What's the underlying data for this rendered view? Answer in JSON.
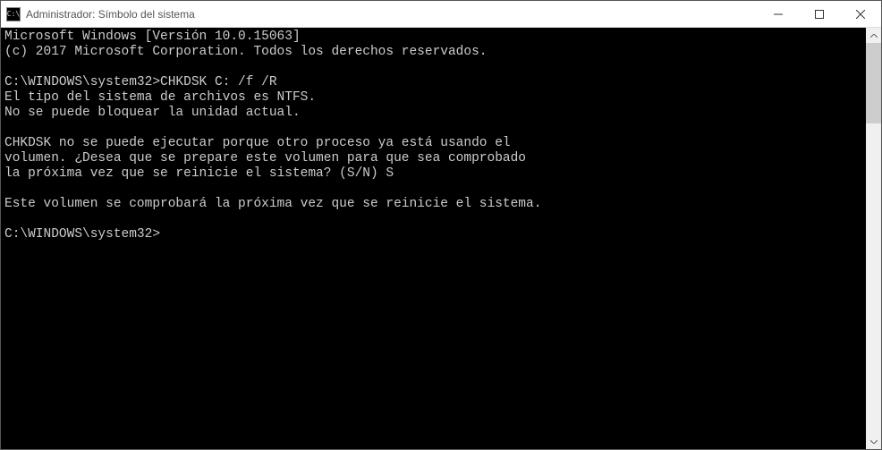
{
  "window": {
    "title": "Administrador: Símbolo del sistema",
    "icon_text": "C:\\"
  },
  "terminal": {
    "lines": [
      "Microsoft Windows [Versión 10.0.15063]",
      "(c) 2017 Microsoft Corporation. Todos los derechos reservados.",
      "",
      "C:\\WINDOWS\\system32>CHKDSK C: /f /R",
      "El tipo del sistema de archivos es NTFS.",
      "No se puede bloquear la unidad actual.",
      "",
      "CHKDSK no se puede ejecutar porque otro proceso ya está usando el",
      "volumen. ¿Desea que se prepare este volumen para que sea comprobado",
      "la próxima vez que se reinicie el sistema? (S/N) S",
      "",
      "Este volumen se comprobará la próxima vez que se reinicie el sistema.",
      "",
      "C:\\WINDOWS\\system32>"
    ]
  }
}
